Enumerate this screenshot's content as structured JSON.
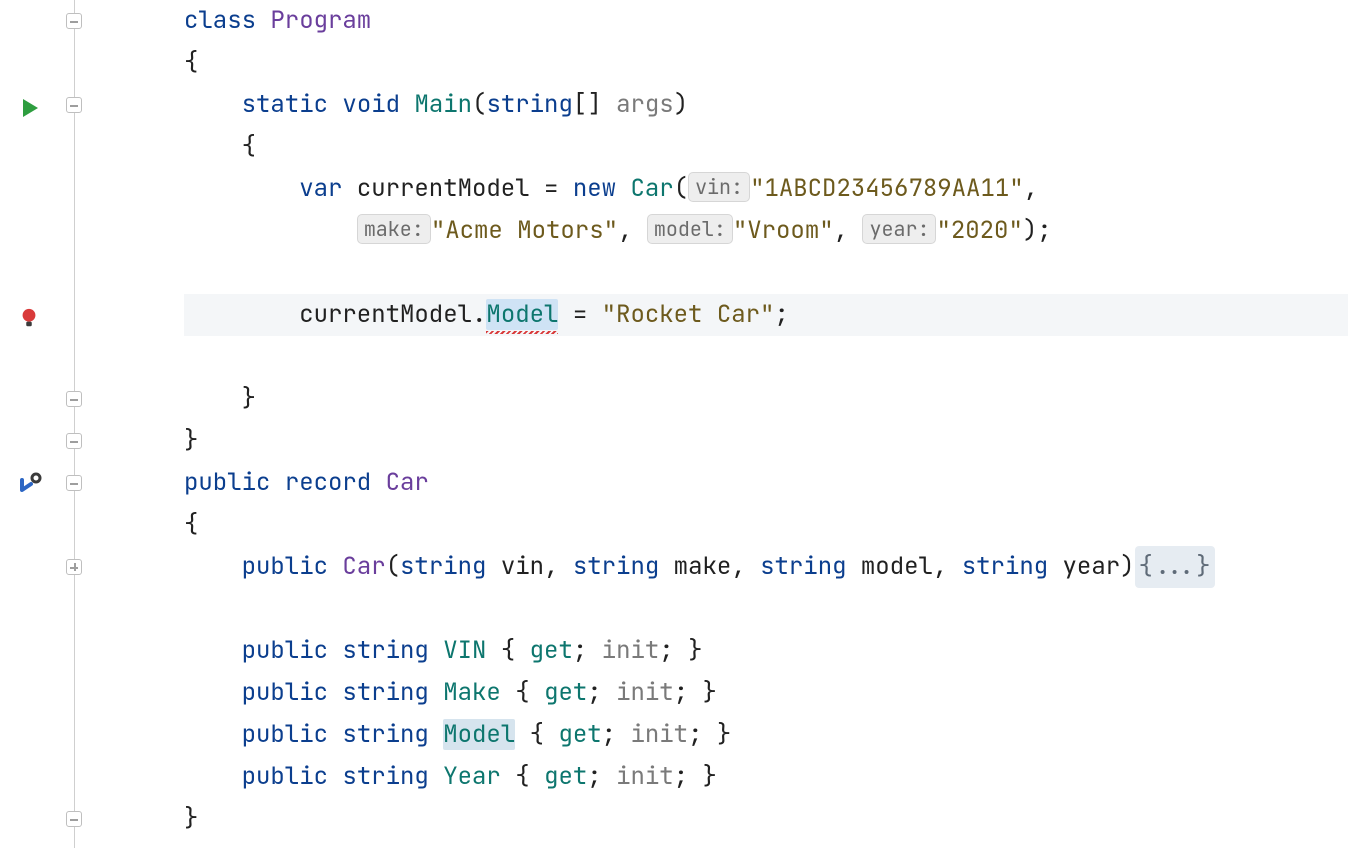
{
  "line_height": 42,
  "code": {
    "class_kw": "class",
    "class_name": "Program",
    "open_brace": "{",
    "close_brace": "}",
    "static_kw": "static",
    "void_kw": "void",
    "main_name": "Main",
    "string_kw": "string",
    "args_name": "args",
    "brackets": "[]",
    "var_kw": "var",
    "current_model": "currentModel",
    "equals": "=",
    "new_kw": "new",
    "car_type": "Car",
    "inlay_vin": "vin:",
    "inlay_make": "make:",
    "inlay_model": "model:",
    "inlay_year": "year:",
    "str_vin": "\"1ABCD23456789AA11\"",
    "str_make": "\"Acme Motors\"",
    "str_model": "\"Vroom\"",
    "str_year": "\"2020\"",
    "dot": ".",
    "model_prop": "Model",
    "rocket_str": "\"Rocket Car\"",
    "semicolon": ";",
    "comma": ",",
    "public_kw": "public",
    "record_kw": "record",
    "car_name": "Car",
    "param_vin": "vin",
    "param_make": "make",
    "param_model": "model",
    "param_year": "year",
    "fold_badge": "{...}",
    "prop_vin": "VIN",
    "prop_make": "Make",
    "prop_model": "Model",
    "prop_year": "Year",
    "get_kw": "get",
    "init_kw": "init",
    "lparen": "(",
    "rparen": ")"
  },
  "colors": {
    "keyword": "#0b3e8e",
    "type": "#6a3e9c",
    "property": "#0d766e",
    "string": "#6d5a1d",
    "grey": "#7a7a7a",
    "highlight_bg": "#f4f6f8",
    "selection_bg": "#cfe3f5"
  }
}
